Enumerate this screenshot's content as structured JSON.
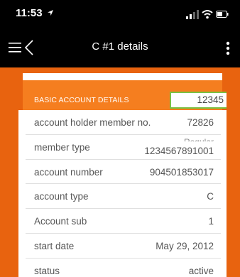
{
  "status_bar": {
    "time": "11:53",
    "location_arrow": "location-arrow-icon"
  },
  "nav": {
    "title": "C #1 details",
    "menu_icon": "hamburger-icon",
    "back_icon": "chevron-left-icon",
    "more_icon": "more-vertical-icon"
  },
  "card": {
    "section_title": "BASIC ACCOUNT DETAILS",
    "highlighted_value": "12345",
    "rows": [
      {
        "label": "account holder member no.",
        "value": "72826"
      },
      {
        "label": "member type",
        "value_under": "Regular",
        "value": "1234567891001"
      },
      {
        "label": "account number",
        "value": "904501853017"
      },
      {
        "label": "account type",
        "value": "C"
      },
      {
        "label": "Account sub",
        "value": "1"
      },
      {
        "label": "start date",
        "value": "May 29, 2012"
      },
      {
        "label": "status",
        "value": "active"
      }
    ]
  },
  "colors": {
    "brand_orange": "#e8630f",
    "header_orange": "#f57e1f",
    "highlight_green": "#7ac142"
  }
}
